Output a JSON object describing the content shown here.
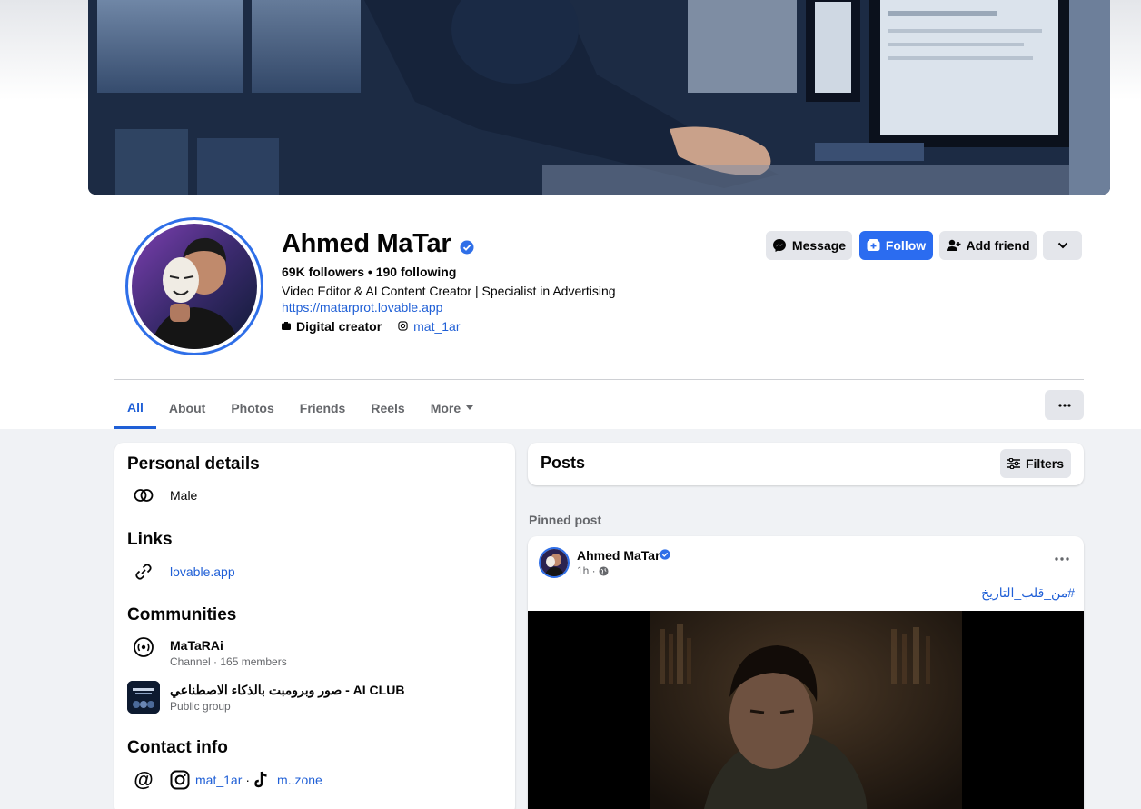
{
  "profile": {
    "name": "Ahmed MaTar",
    "stats": "69K followers • 190 following",
    "bio": "Video Editor & AI Content Creator | Specialist in Advertising",
    "website": "https://matarprot.lovable.app",
    "category": "Digital creator",
    "instagram": "mat_1ar"
  },
  "actions": {
    "message": "Message",
    "follow": "Follow",
    "add_friend": "Add friend"
  },
  "tabs": [
    "All",
    "About",
    "Photos",
    "Friends",
    "Reels",
    "More"
  ],
  "intro": {
    "personal_title": "Personal details",
    "gender": "Male",
    "links_title": "Links",
    "link": "lovable.app",
    "communities_title": "Communities",
    "communities": [
      {
        "name": "MaTaRAi",
        "sub": "Channel · 165 members"
      },
      {
        "name": "صور وبرومبت بالذكاء الاصطناعي - AI CLUB",
        "sub": "Public group"
      }
    ],
    "contact_title": "Contact info",
    "contact_instagram": "mat_1ar",
    "contact_separator": "·",
    "contact_tiktok": "m..zone"
  },
  "posts": {
    "title": "Posts",
    "filters": "Filters",
    "pinned_label": "Pinned post",
    "post": {
      "author": "Ahmed MaTar",
      "time": "1h ·",
      "hashtag": "#من_قلب_التاريخ"
    }
  },
  "colors": {
    "accent": "#1f5fd6",
    "follow_button": "#2b6cf0",
    "background": "#f0f2f5"
  }
}
